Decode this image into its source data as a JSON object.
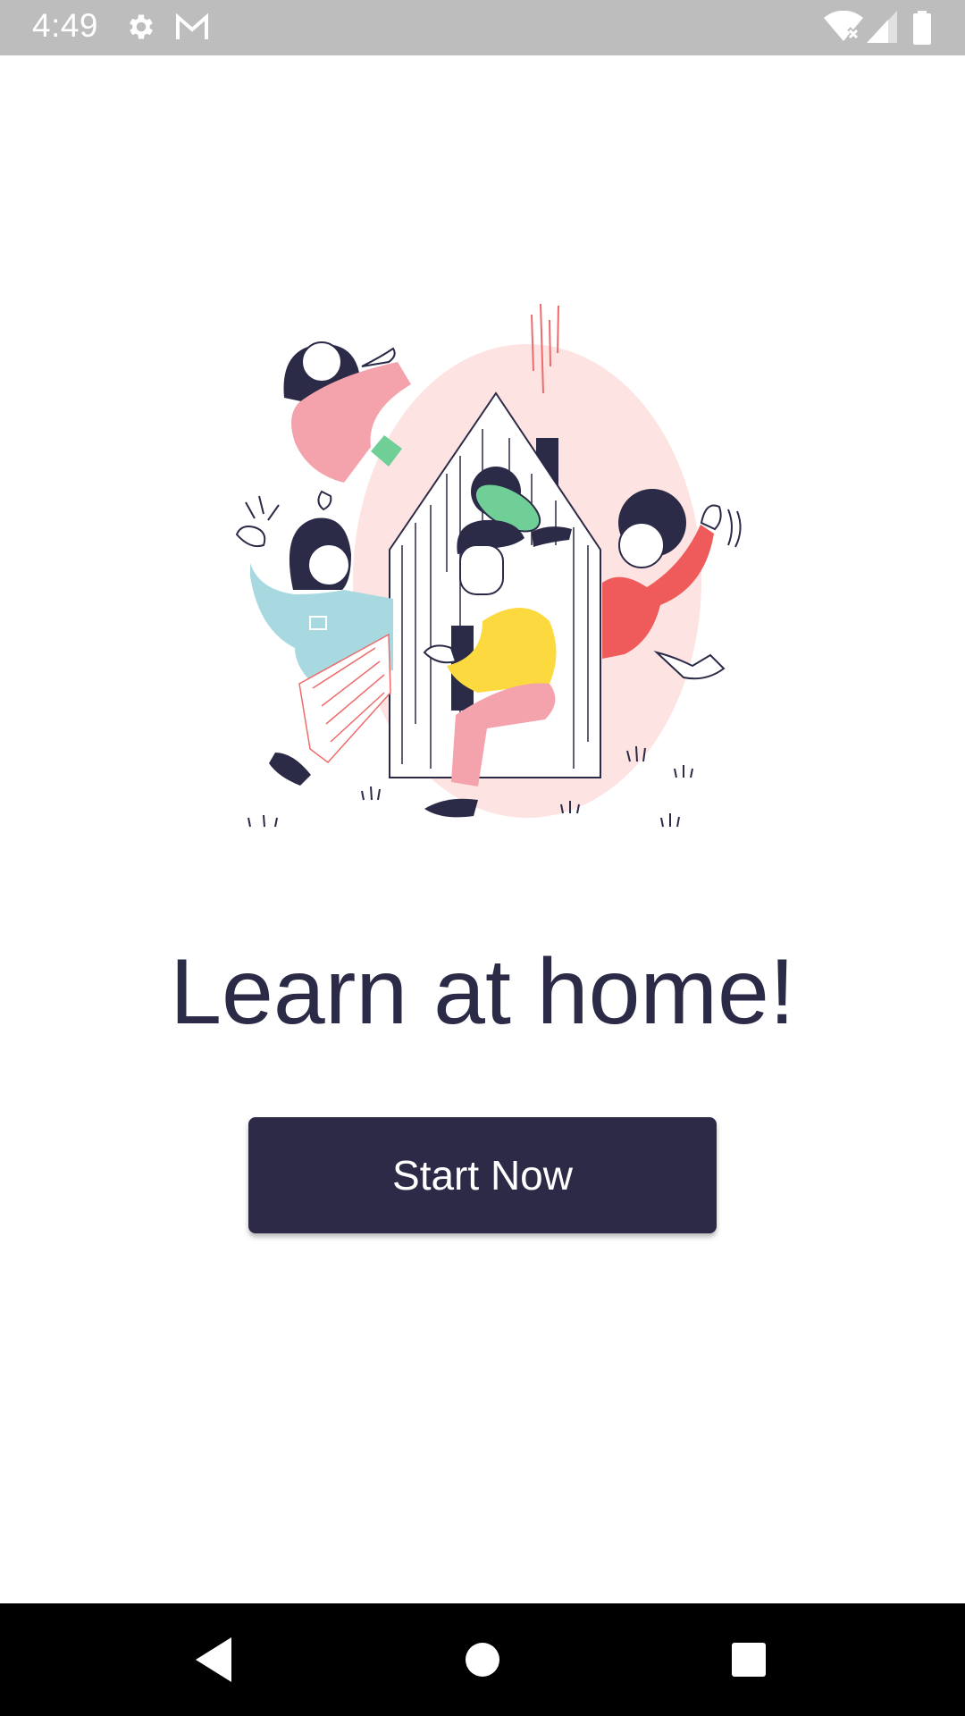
{
  "status_bar": {
    "time": "4:49",
    "icons": [
      "settings-icon",
      "gmail-icon",
      "wifi-icon",
      "cellular-signal-icon",
      "battery-icon"
    ]
  },
  "illustration": {
    "name": "people-house-illustration",
    "colors": {
      "circle": "#fde3e1",
      "outline": "#2b2a47",
      "pink": "#f4a3ad",
      "teal": "#a8d8e0",
      "yellow": "#fbd93f",
      "red": "#ef5b5b",
      "green": "#6fcf97"
    }
  },
  "main": {
    "title": "Learn at home!",
    "start_button_label": "Start Now"
  },
  "theme": {
    "primary": "#2c2a47",
    "status_bar_bg": "#bdbdbd",
    "nav_bar_bg": "#000000"
  },
  "nav_bar": {
    "buttons": [
      "back-icon",
      "home-icon",
      "recents-icon"
    ]
  }
}
